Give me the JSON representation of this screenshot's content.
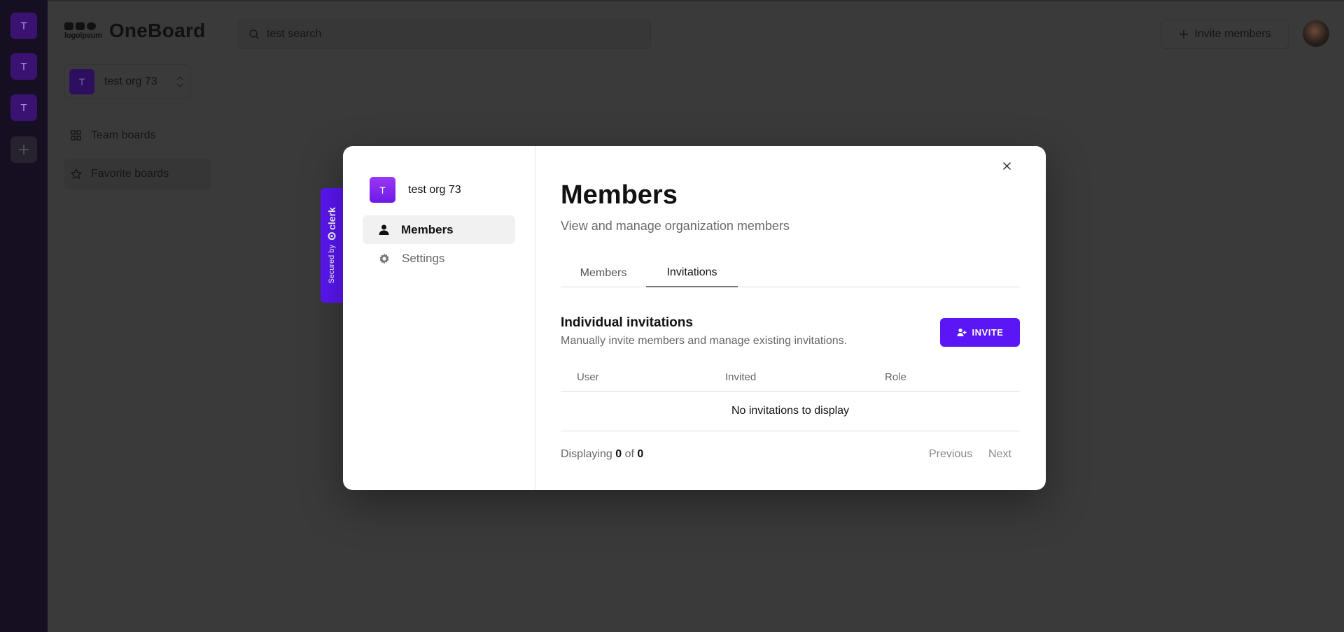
{
  "rail": {
    "items": [
      "T",
      "T",
      "T"
    ]
  },
  "header": {
    "logo_text": "logoipsum",
    "brand": "OneBoard",
    "search_value": "test search",
    "invite_label": "Invite members"
  },
  "sidebar": {
    "org_initial": "T",
    "org_name": "test org 73",
    "nav": [
      {
        "label": "Team boards",
        "icon": "grid-icon"
      },
      {
        "label": "Favorite boards",
        "icon": "star-icon"
      }
    ]
  },
  "clerk_tab": {
    "secured_by": "Secured by",
    "brand": "clerk"
  },
  "modal": {
    "org_initial": "T",
    "org_name": "test org 73",
    "nav": [
      {
        "label": "Members",
        "icon": "person-icon",
        "active": true
      },
      {
        "label": "Settings",
        "icon": "gear-icon",
        "active": false
      }
    ],
    "title": "Members",
    "subtitle": "View and manage organization members",
    "tabs": [
      "Members",
      "Invitations"
    ],
    "active_tab": "Invitations",
    "section": {
      "title": "Individual invitations",
      "description": "Manually invite members and manage existing invitations.",
      "invite_label": "INVITE"
    },
    "table": {
      "columns": [
        "User",
        "Invited",
        "Role"
      ],
      "empty_text": "No invitations to display"
    },
    "pagination": {
      "displaying_label": "Displaying",
      "shown": "0",
      "of_label": "of",
      "total": "0",
      "previous": "Previous",
      "next": "Next"
    }
  },
  "colors": {
    "accent": "#5b16f5",
    "org_badge": "#8a2cf0"
  }
}
